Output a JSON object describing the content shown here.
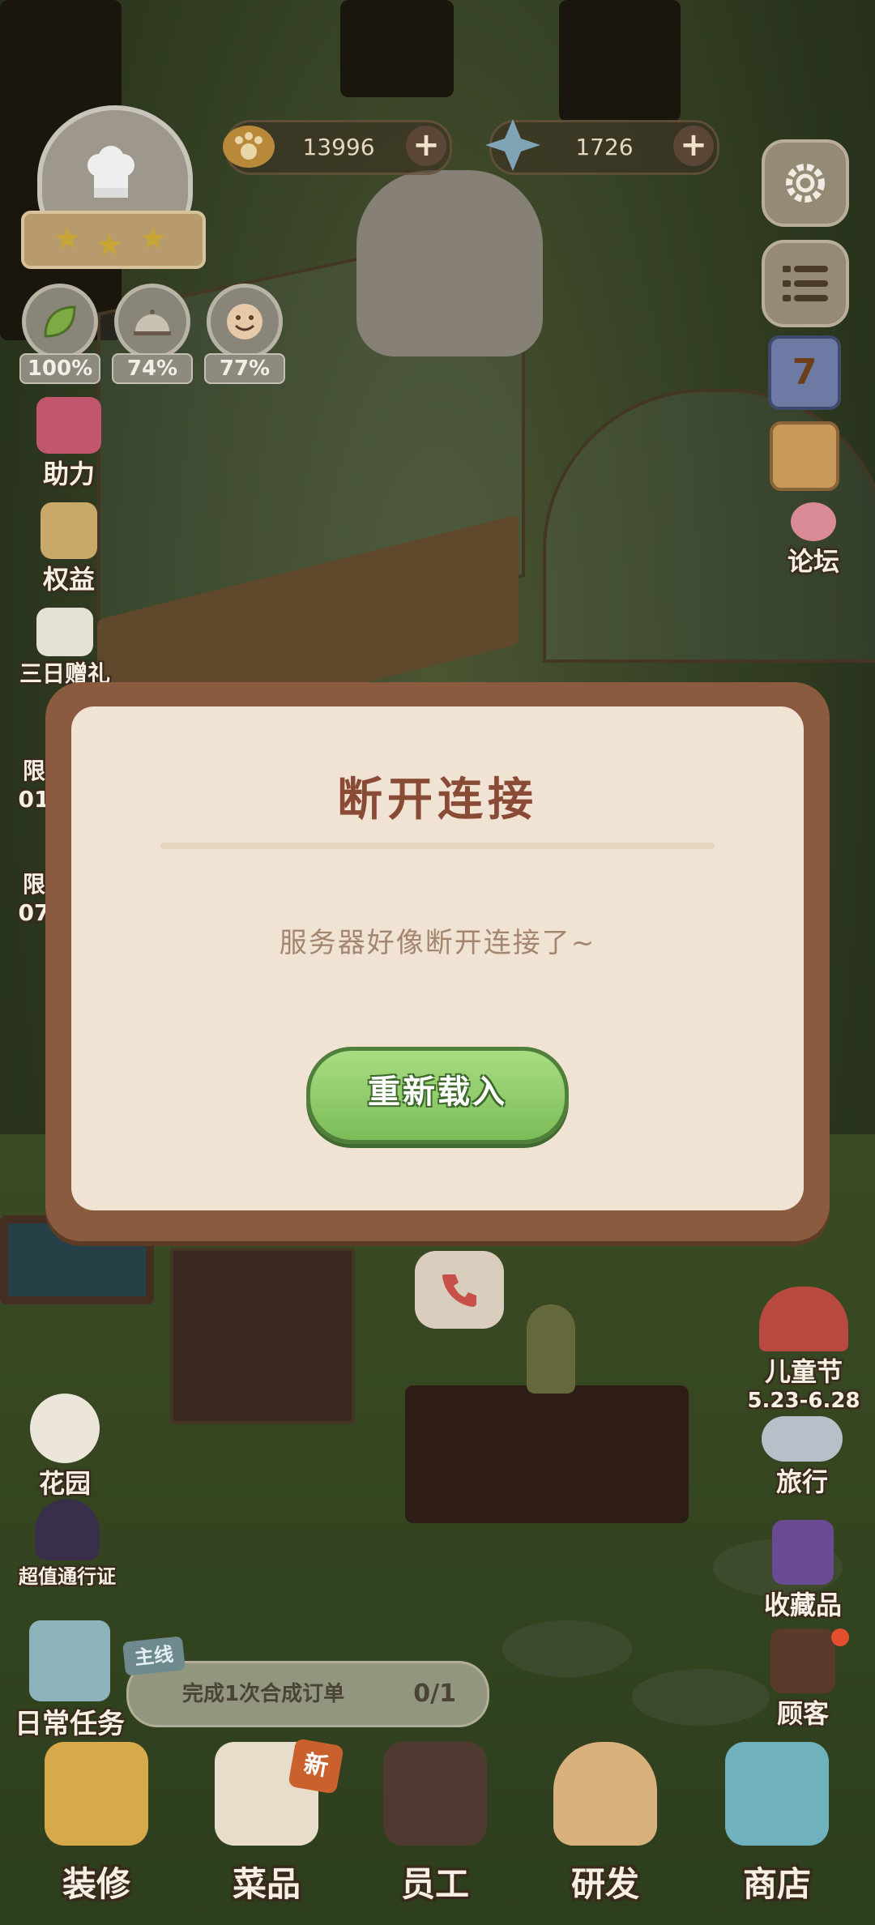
{
  "resources": {
    "coins": "13996",
    "gems": "1726",
    "plus": "+"
  },
  "stats": [
    {
      "icon": "leaf-icon",
      "value": "100%"
    },
    {
      "icon": "cloche-icon",
      "value": "74%"
    },
    {
      "icon": "smiley-icon",
      "value": "77%"
    }
  ],
  "left_menu": {
    "help": "助力",
    "benefits": "权益",
    "three_day_gift": "三日赠礼",
    "limited_1": "限",
    "limited_1_time": "01",
    "limited_2": "限",
    "limited_2_time": "07",
    "garden": "花园",
    "pass": "超值通行证",
    "daily_tasks": "日常任务"
  },
  "right_menu": {
    "calendar_day": "7",
    "forum": "论坛",
    "childrens_day": "儿童节",
    "childrens_day_dates": "5.23-6.28",
    "travel": "旅行",
    "collection": "收藏品",
    "customers": "顾客"
  },
  "dialog": {
    "title": "断开连接",
    "message": "服务器好像断开连接了~",
    "reload_button": "重新载入"
  },
  "task": {
    "tag": "主线",
    "text": "完成1次合成订单",
    "progress": "0/1"
  },
  "bottom_nav": {
    "new_badge": "新",
    "items": [
      "装修",
      "菜品",
      "员工",
      "研发",
      "商店"
    ]
  }
}
